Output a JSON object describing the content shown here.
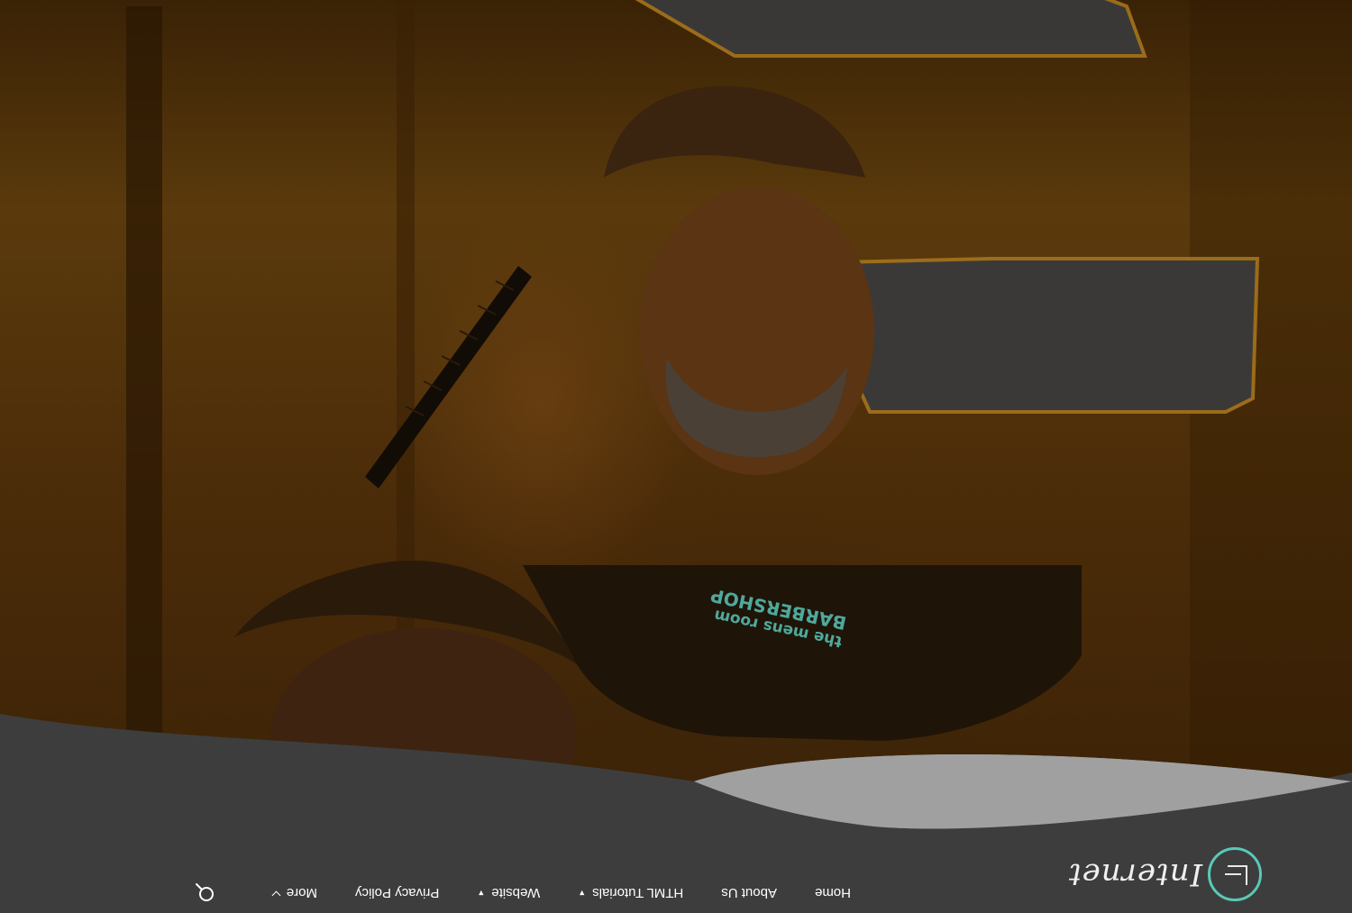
{
  "navbar": {
    "logo_text": "Internet",
    "menu": [
      {
        "label": "Home"
      },
      {
        "label": "About Us"
      },
      {
        "label": "HTML Tutorials"
      },
      {
        "label": "Website"
      },
      {
        "label": "Privacy Policy"
      },
      {
        "label": "More"
      }
    ]
  },
  "hero": {
    "shirt_text_line1": "the mens room",
    "shirt_text_line2": "BARBERSHOP"
  },
  "colors": {
    "navbar_bg": "#3d3d3d",
    "accent": "#59c9b7",
    "hero_tint": "#4b2c09",
    "wave_light": "#a0a0a0"
  }
}
